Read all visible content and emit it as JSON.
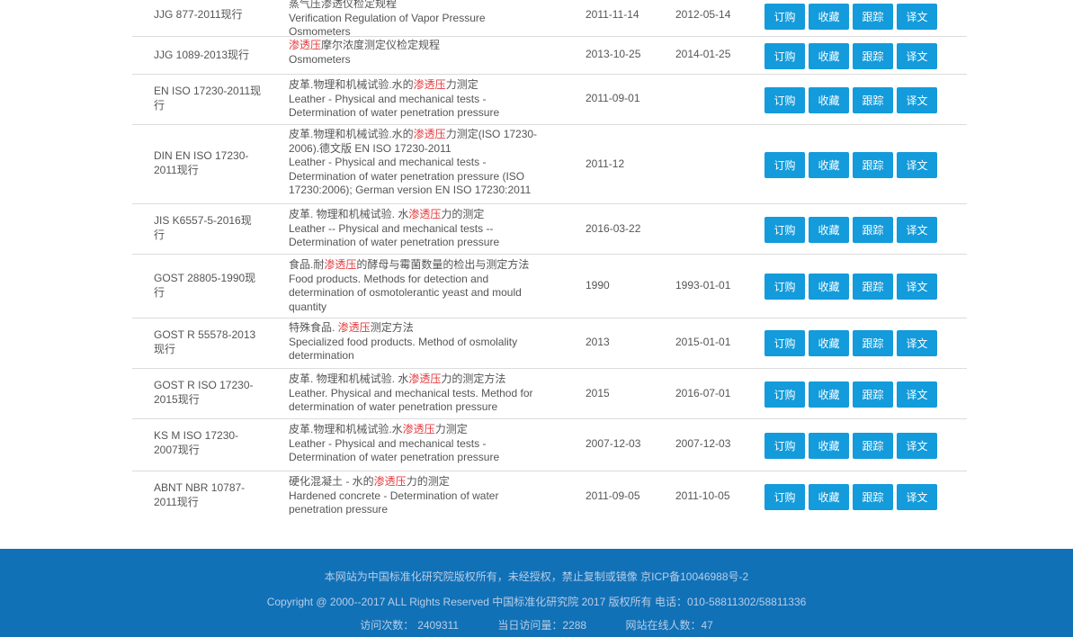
{
  "buttons": {
    "order": "订购",
    "collect": "收藏",
    "track": "跟踪",
    "translate": "译文"
  },
  "highlight_term": "渗透压",
  "rows": [
    {
      "code": "JJG 877-2011现行",
      "title_pre": "蒸气压渗透仪检定规程",
      "title_hl": "",
      "title_post": "",
      "english": "Verification Regulation of Vapor Pressure Osmometers",
      "date1": "2011-11-14",
      "date2": "2012-05-14"
    },
    {
      "code": "JJG 1089-2013现行",
      "title_pre": "",
      "title_hl": "渗透压",
      "title_post": "摩尔浓度测定仪检定规程",
      "english": "Osmometers",
      "date1": "2013-10-25",
      "date2": "2014-01-25"
    },
    {
      "code": "EN ISO 17230-2011现行",
      "title_pre": "皮革.物理和机械试验.水的",
      "title_hl": "渗透压",
      "title_post": "力测定",
      "english": "Leather - Physical and mechanical tests - Determination of water penetration pressure",
      "date1": "2011-09-01",
      "date2": ""
    },
    {
      "code": "DIN EN ISO 17230-2011现行",
      "title_pre": "皮革.物理和机械试验.水的",
      "title_hl": "渗透压",
      "title_post": "力测定(ISO 17230-2006).德文版 EN ISO 17230-2011",
      "english": "Leather - Physical and mechanical tests - Determination of water penetration pressure (ISO 17230:2006); German version EN ISO 17230:2011",
      "date1": "2011-12",
      "date2": ""
    },
    {
      "code": "JIS K6557-5-2016现行",
      "title_pre": "皮革. 物理和机械试验. 水",
      "title_hl": "渗透压",
      "title_post": "力的测定",
      "english": "Leather -- Physical and mechanical tests -- Determination of water penetration pressure",
      "date1": "2016-03-22",
      "date2": ""
    },
    {
      "code": "GOST 28805-1990现行",
      "title_pre": "食品.耐",
      "title_hl": "渗透压",
      "title_post": "的酵母与霉菌数量的检出与测定方法",
      "english": "Food products. Methods for detection and determination of osmotolerantic yeast and mould quantity",
      "date1": "1990",
      "date2": "1993-01-01"
    },
    {
      "code": "GOST R 55578-2013现行",
      "title_pre": "特殊食品. ",
      "title_hl": "渗透压",
      "title_post": "测定方法",
      "english": "Specialized food products. Method of osmolality determination",
      "date1": "2013",
      "date2": "2015-01-01"
    },
    {
      "code": "GOST R ISO 17230-2015现行",
      "title_pre": "皮革. 物理和机械试验. 水",
      "title_hl": "渗透压",
      "title_post": "力的测定方法",
      "english": "Leather. Physical and mechanical tests. Method for determination of water penetration pressure",
      "date1": "2015",
      "date2": "2016-07-01"
    },
    {
      "code": "KS M ISO 17230-2007现行",
      "title_pre": "皮革.物理和机械试验.水",
      "title_hl": "渗透压",
      "title_post": "力测定",
      "english": "Leather - Physical and mechanical tests - Determination of water penetration pressure",
      "date1": "2007-12-03",
      "date2": "2007-12-03"
    },
    {
      "code": "ABNT NBR 10787-2011现行",
      "title_pre": "硬化混凝土 - 水的",
      "title_hl": "渗透压",
      "title_post": "力的测定",
      "english": "Hardened concrete - Determination of water penetration pressure",
      "date1": "2011-09-05",
      "date2": "2011-10-05"
    }
  ],
  "footer": {
    "line1": "本网站为中国标准化研究院版权所有，未经授权，禁止复制或镜像 京ICP备10046988号-2",
    "line2": "Copyright @ 2000--2017 ALL Rights Reserved 中国标准化研究院 2017 版权所有 电话：010-58811302/58811336",
    "visits_label": "访问次数：",
    "visits": "2409311",
    "today_label": "当日访问量：",
    "today": "2288",
    "online_label": "网站在线人数：",
    "online": "47"
  },
  "colors": {
    "button": "#139bdb",
    "highlight": "#e4393c",
    "footer": "#1171b7"
  }
}
